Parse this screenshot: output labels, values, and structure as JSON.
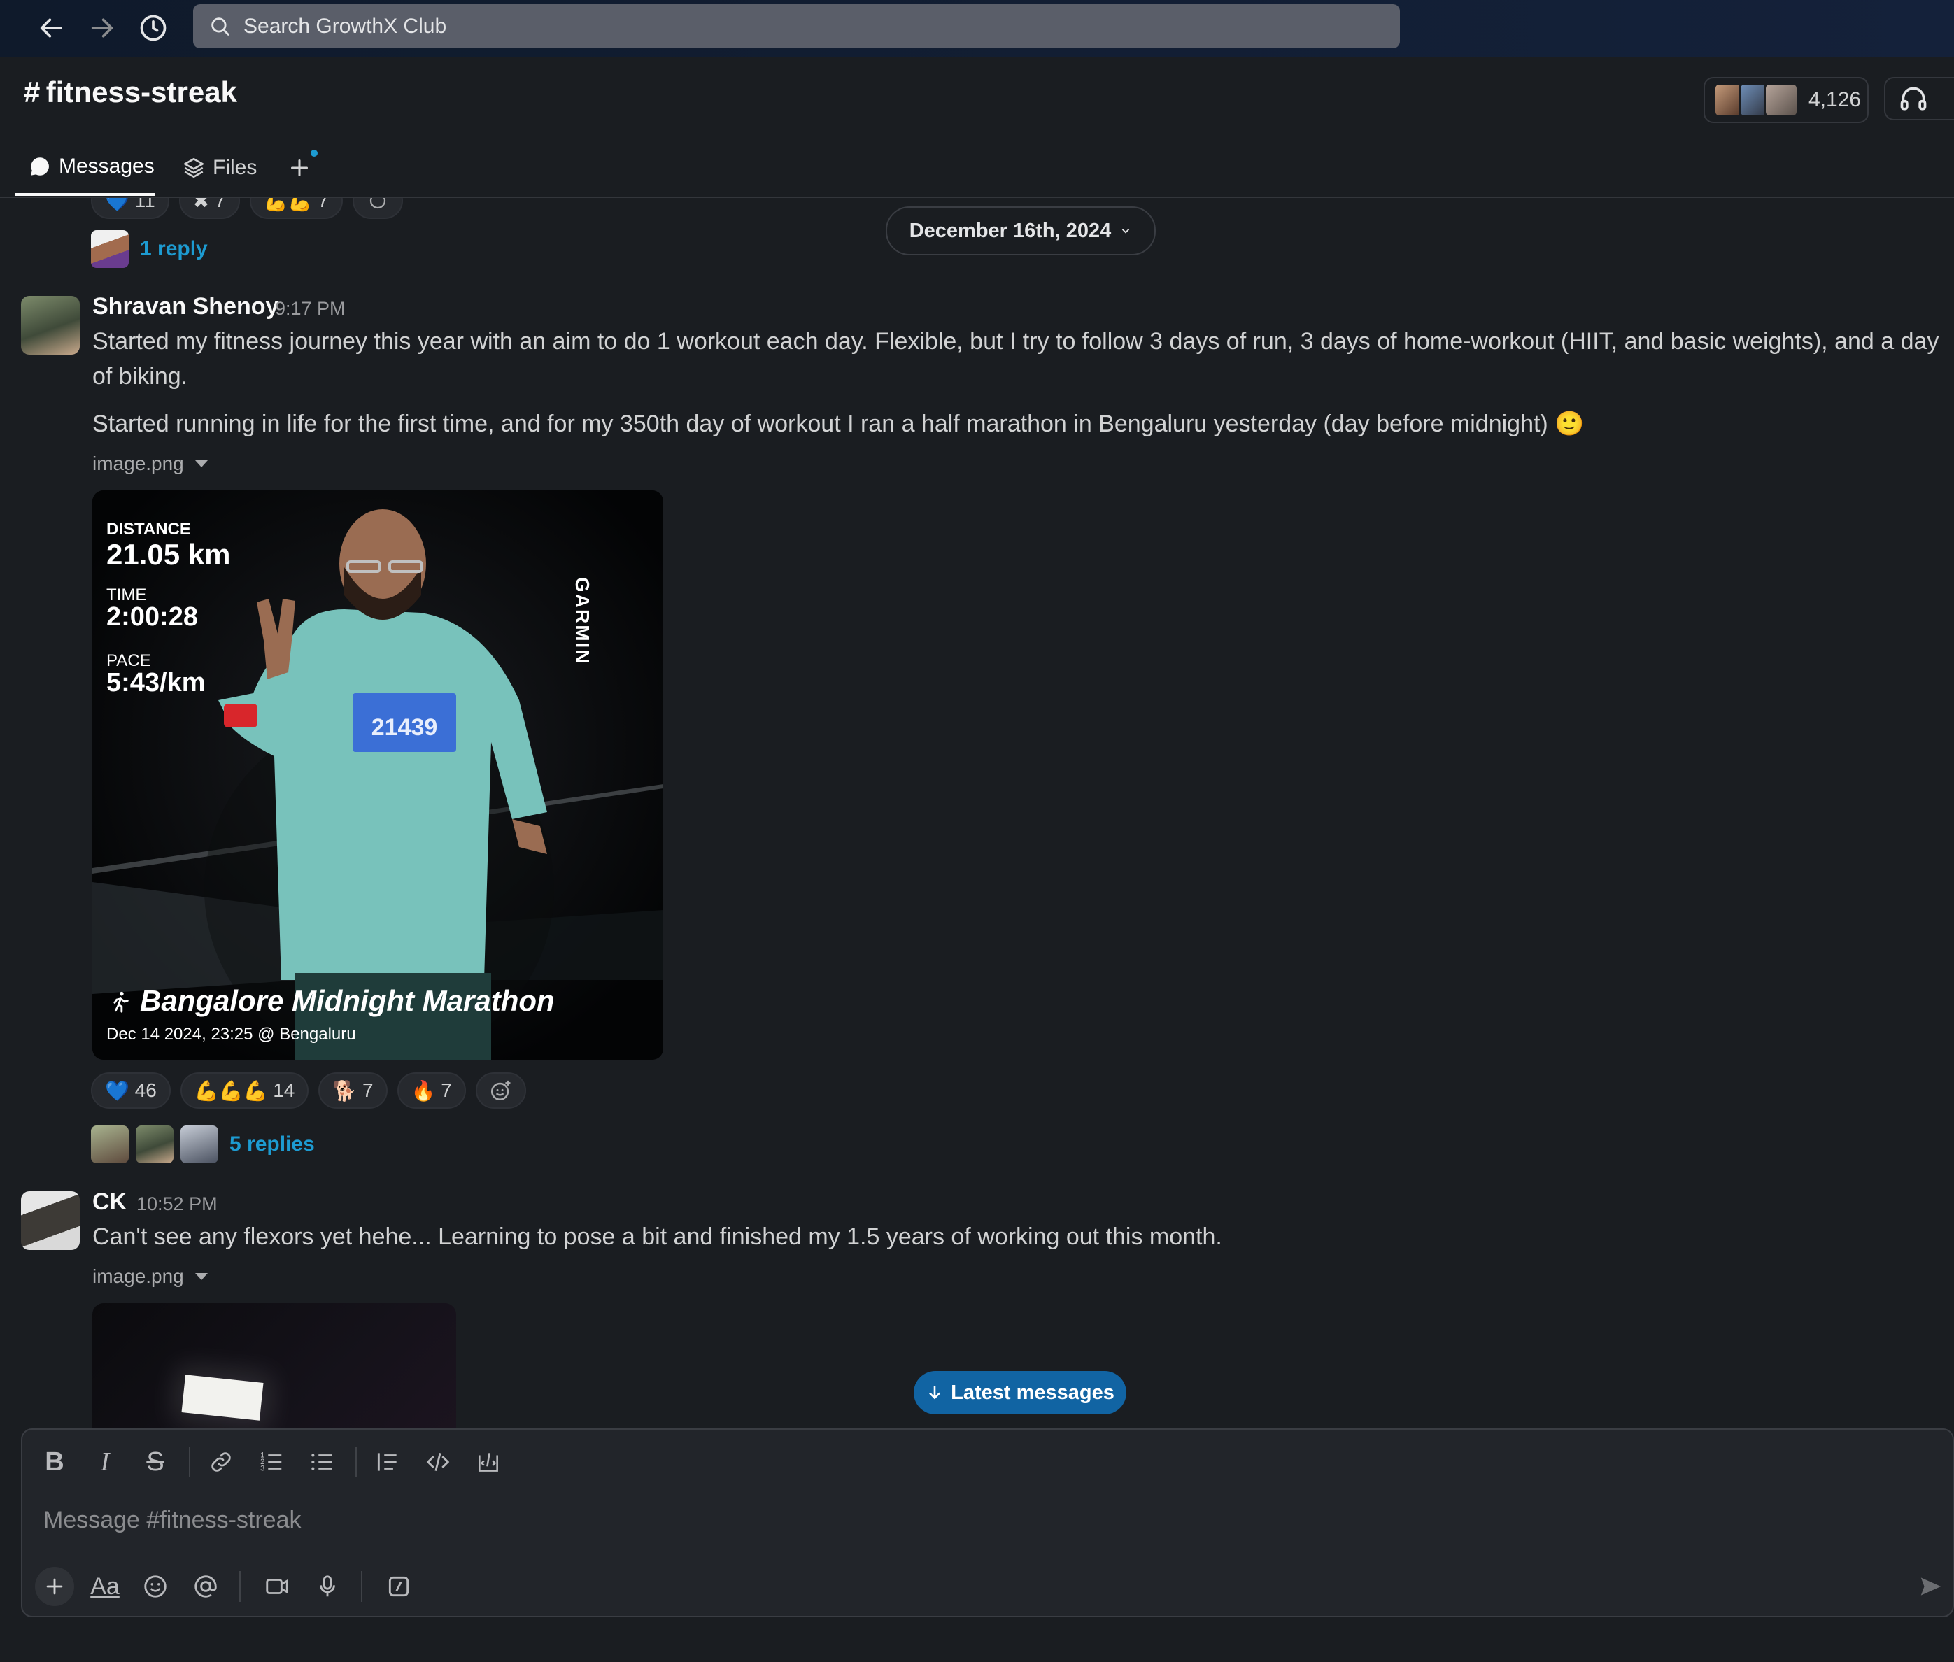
{
  "search": {
    "placeholder": "Search GrowthX Club"
  },
  "channel": {
    "name": "fitness-streak",
    "hash": "#",
    "member_count": "4,126"
  },
  "tabs": [
    {
      "label": "Messages"
    },
    {
      "label": "Files"
    }
  ],
  "date_divider": "December 16th, 2024",
  "top_partial": {
    "reactions": [
      {
        "emoji": "💙",
        "count": "11"
      },
      {
        "emoji": "✖",
        "count": "7"
      },
      {
        "emoji": "💪💪",
        "count": "7"
      }
    ],
    "reply_label": "1 reply"
  },
  "messages": [
    {
      "author": "Shravan Shenoy",
      "time": "9:17 PM",
      "paragraphs": [
        "Started my fitness journey this year with an aim to do 1 workout each day. Flexible, but I try to follow 3 days of run, 3 days of home-workout (HIIT, and basic weights), and a day of biking.",
        "Started running in life for the first time, and for my 350th day of workout I ran a half marathon in Bengaluru yesterday (day before midnight) 🙂"
      ],
      "file_name": "image.png",
      "image": {
        "brand": "GARMIN",
        "distance_label": "DISTANCE",
        "distance": "21.05 km",
        "time_label": "TIME",
        "time": "2:00:28",
        "pace_label": "PACE",
        "pace": "5:43/km",
        "bib": "21439",
        "event": "Bangalore Midnight Marathon",
        "event_meta": "Dec 14 2024, 23:25 @ Bengaluru"
      },
      "reactions": [
        {
          "emoji": "💙",
          "count": "46"
        },
        {
          "emoji": "💪💪💪",
          "count": "14"
        },
        {
          "emoji": "🐕",
          "count": "7"
        },
        {
          "emoji": "🔥",
          "count": "7"
        }
      ],
      "reply_label": "5 replies"
    },
    {
      "author": "CK",
      "time": "10:52 PM",
      "paragraphs": [
        "Can't see any flexors yet hehe...  Learning to pose a bit and finished my 1.5 years of working out this month."
      ],
      "file_name": "image.png"
    }
  ],
  "latest_button": "Latest messages",
  "composer": {
    "placeholder": "Message #fitness-streak",
    "text_format_label": "Aa"
  },
  "colors": {
    "accent": "#1164a3",
    "link": "#1d9bd1",
    "background": "#1a1d21"
  }
}
